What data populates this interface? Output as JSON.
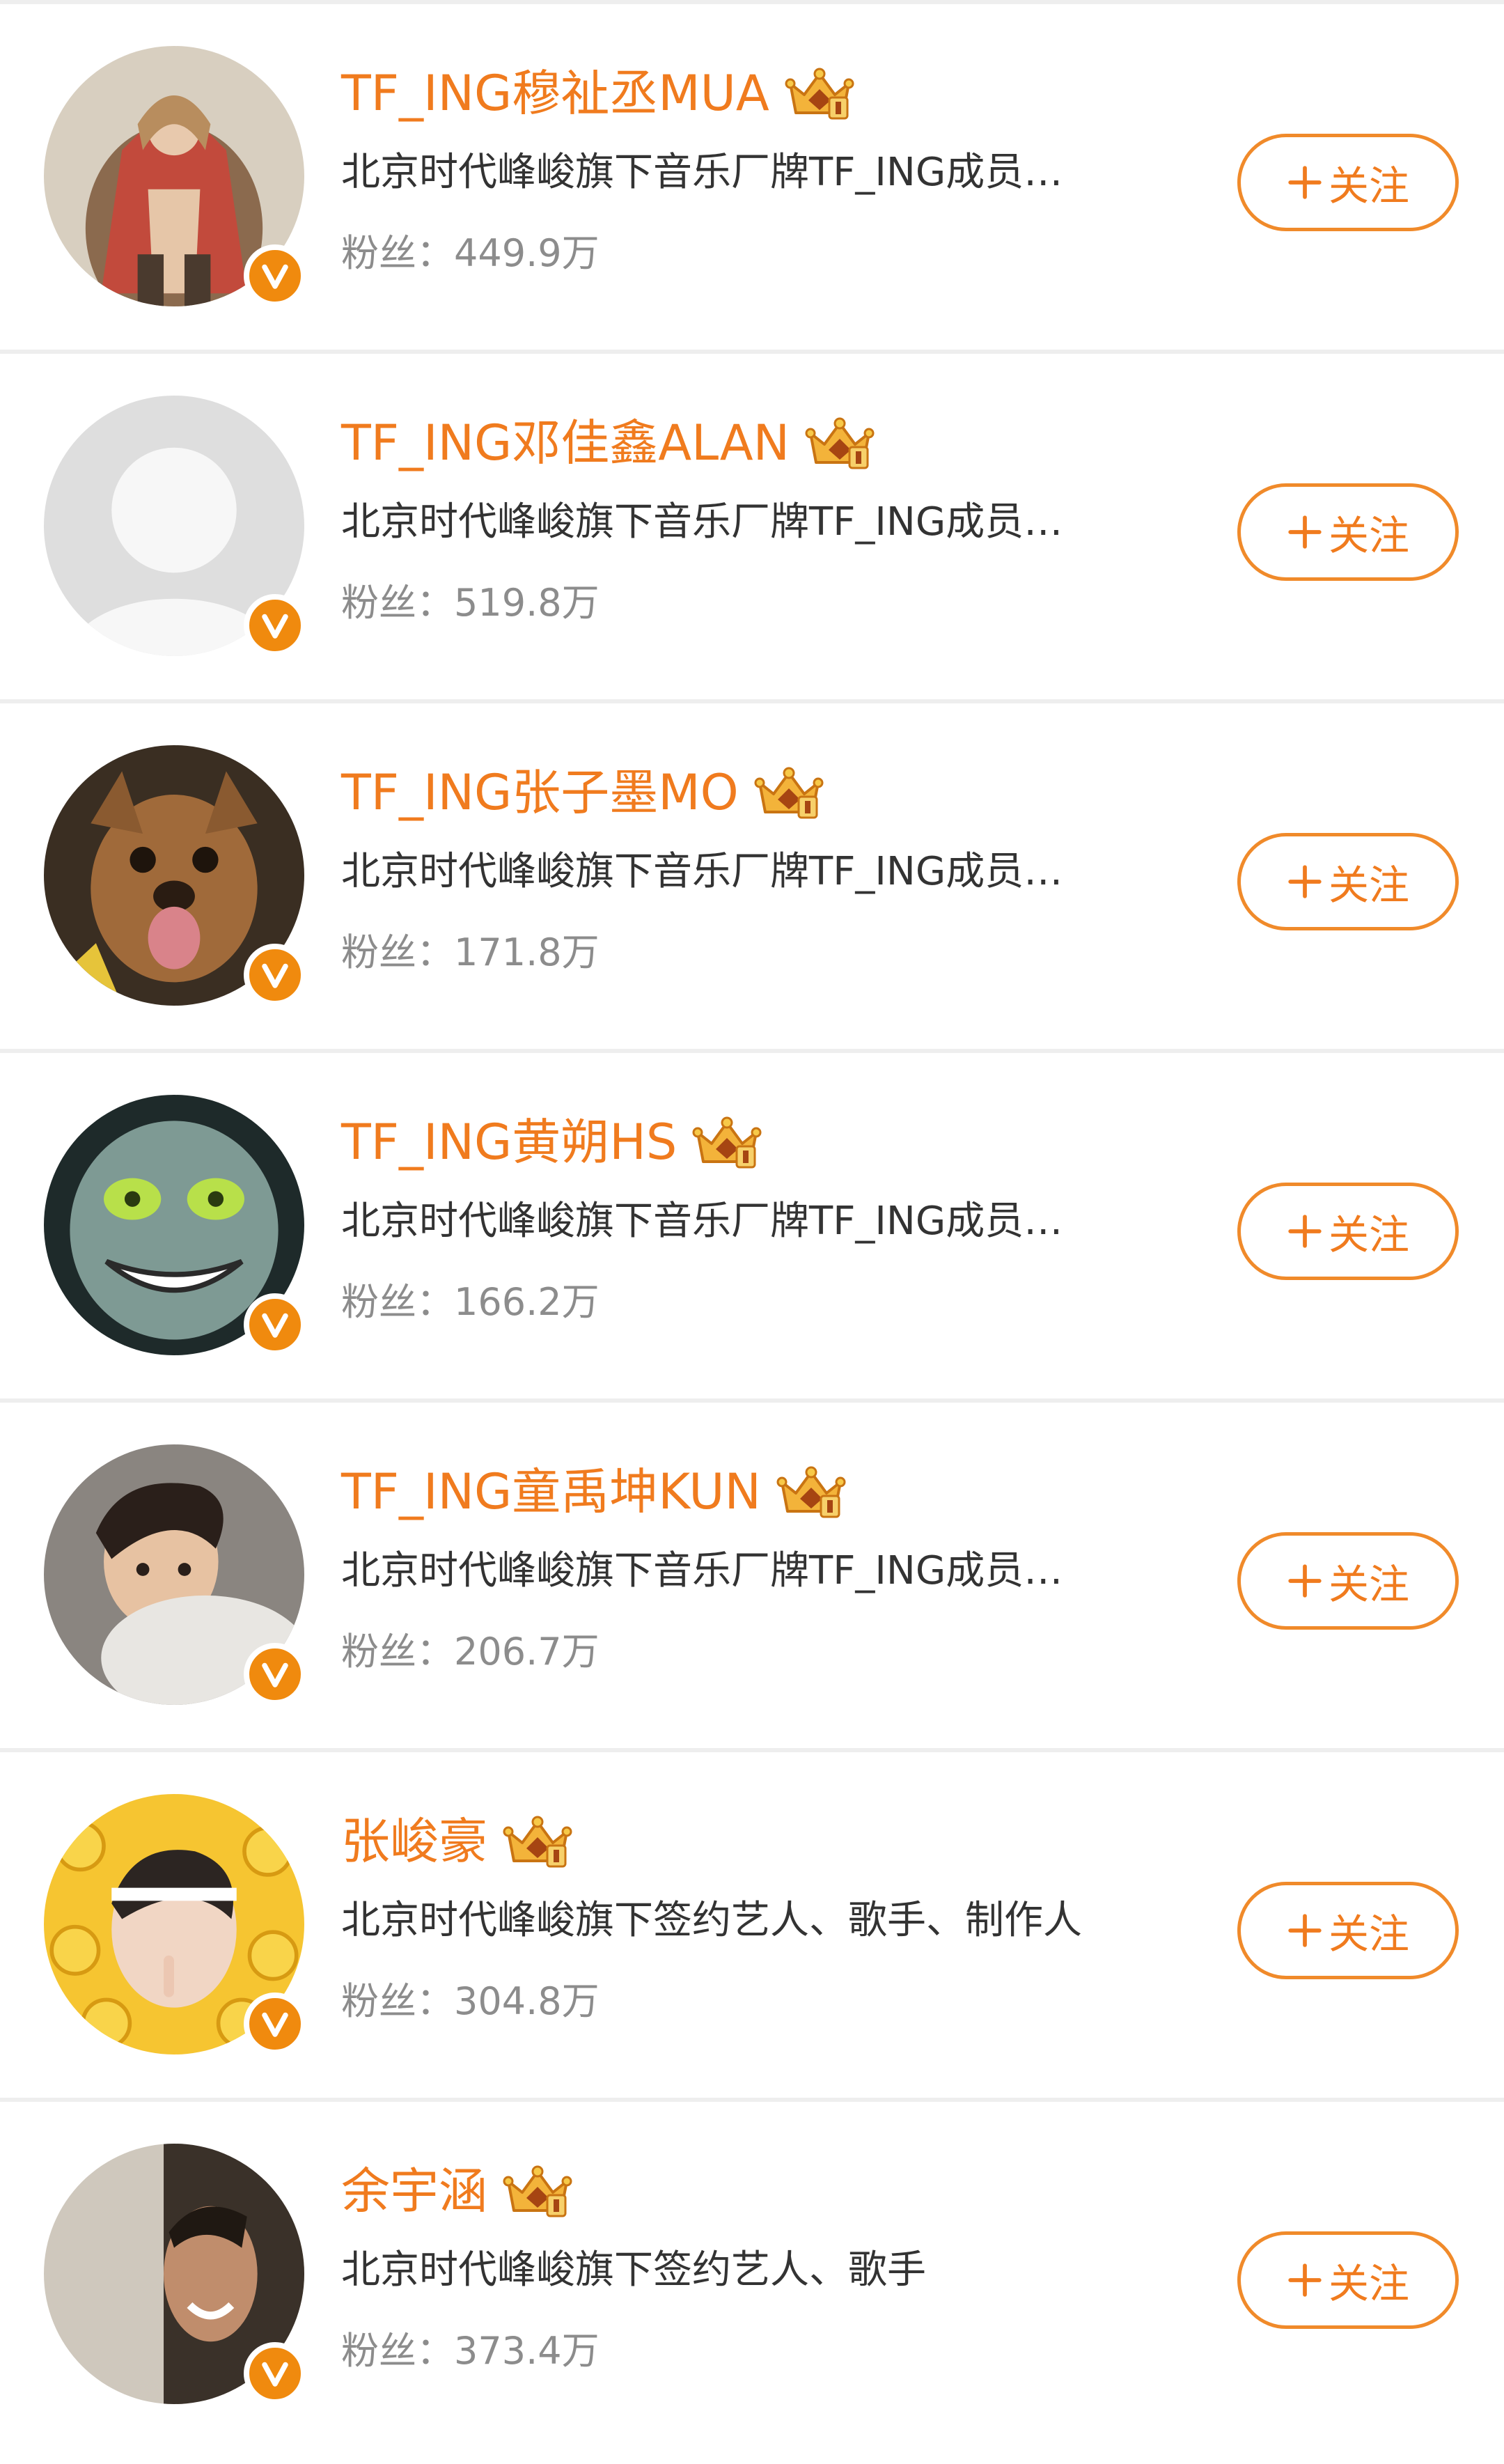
{
  "colors": {
    "accent": "#f07b1e",
    "badge": "#f08a0e",
    "divider": "#eeeeee",
    "text": "#333333",
    "muted": "#8c8c8c"
  },
  "icons": {
    "verified": "verified-v-badge-icon",
    "crown": "crown-icon",
    "plus": "plus-icon"
  },
  "users": [
    {
      "name": "TF_ING穆祉丞MUA",
      "desc": "北京时代峰峻旗下音乐厂牌TF_ING成员…",
      "fans": "粉丝：449.9万",
      "follow_label": "关注",
      "avatar": "photo"
    },
    {
      "name": "TF_ING邓佳鑫ALAN",
      "desc": "北京时代峰峻旗下音乐厂牌TF_ING成员…",
      "fans": "粉丝：519.8万",
      "follow_label": "关注",
      "avatar": "default"
    },
    {
      "name": "TF_ING张子墨MO",
      "desc": "北京时代峰峻旗下音乐厂牌TF_ING成员…",
      "fans": "粉丝：171.8万",
      "follow_label": "关注",
      "avatar": "dog"
    },
    {
      "name": "TF_ING黄朔HS",
      "desc": "北京时代峰峻旗下音乐厂牌TF_ING成员…",
      "fans": "粉丝：166.2万",
      "follow_label": "关注",
      "avatar": "green-face"
    },
    {
      "name": "TF_ING童禹坤KUN",
      "desc": "北京时代峰峻旗下音乐厂牌TF_ING成员…",
      "fans": "粉丝：206.7万",
      "follow_label": "关注",
      "avatar": "photo"
    },
    {
      "name": "张峻豪",
      "desc": "北京时代峰峻旗下签约艺人、歌手、制作人",
      "fans": "粉丝：304.8万",
      "follow_label": "关注",
      "avatar": "emoji"
    },
    {
      "name": "余宇涵",
      "desc": "北京时代峰峻旗下签约艺人、歌手",
      "fans": "粉丝：373.4万",
      "follow_label": "关注",
      "avatar": "photo"
    }
  ]
}
